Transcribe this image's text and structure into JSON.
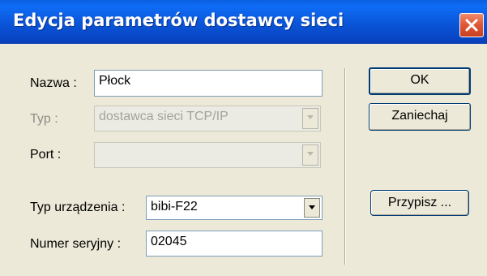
{
  "window": {
    "title": "Edycja parametrów dostawcy sieci"
  },
  "form": {
    "nazwa_label": "Nazwa :",
    "nazwa_value": "Płock",
    "typ_label": "Typ :",
    "typ_value": "dostawca sieci TCP/IP",
    "port_label": "Port :",
    "port_value": "",
    "typ_urzadzenia_label": "Typ urządzenia :",
    "typ_urzadzenia_value": "bibi-F22",
    "numer_seryjny_label": "Numer seryjny :",
    "numer_seryjny_value": "02045"
  },
  "buttons": {
    "ok": "OK",
    "cancel": "Zaniechaj",
    "assign": "Przypisz ..."
  },
  "icons": {
    "close": "close-icon",
    "dropdown": "chevron-down-icon"
  },
  "colors": {
    "titlebar": "#0a55d8",
    "close_button": "#e2593a",
    "dialog_background": "#ece9d8"
  }
}
